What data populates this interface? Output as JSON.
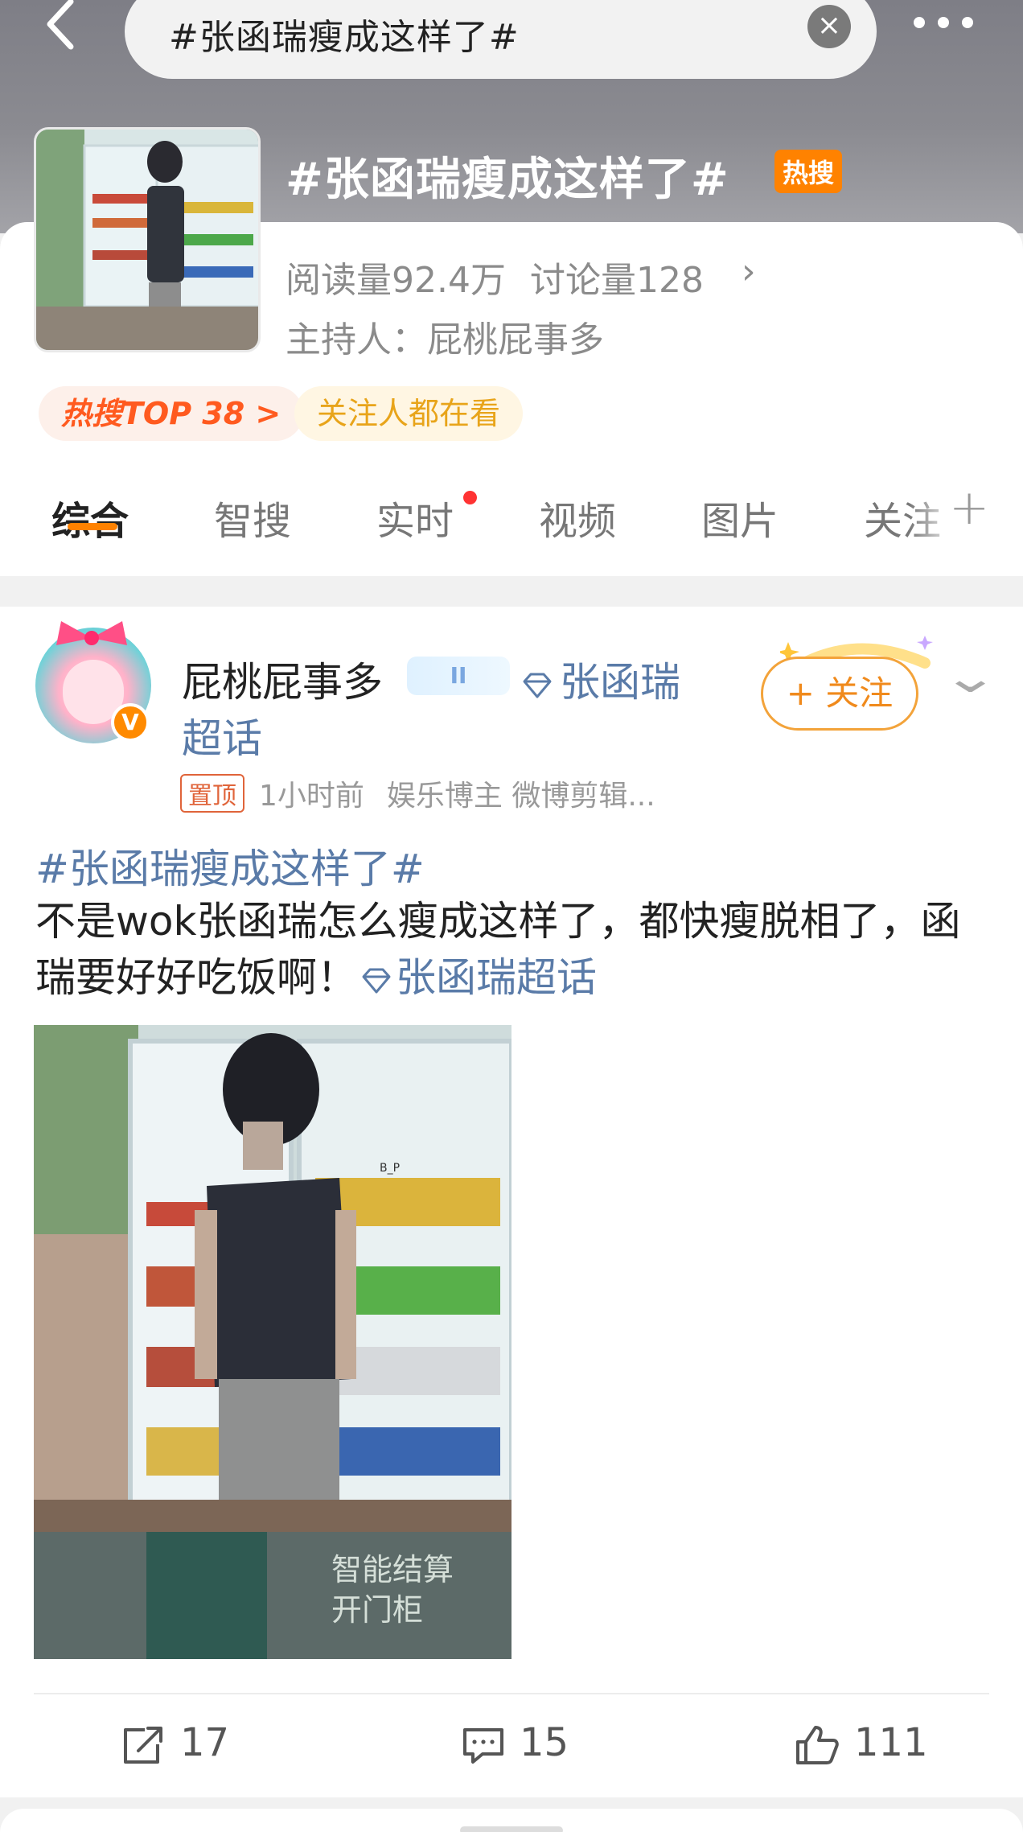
{
  "search": {
    "query": "#张函瑞瘦成这样了#"
  },
  "topic": {
    "title": "#张函瑞瘦成这样了#",
    "badge": "热搜",
    "reads": "阅读量92.4万",
    "discussions": "讨论量128",
    "host": "主持人：屁桃屁事多",
    "chips": [
      "热搜TOP 38 >",
      "关注人都在看"
    ]
  },
  "tabs": [
    {
      "label": "综合",
      "active": true
    },
    {
      "label": "智搜",
      "active": false
    },
    {
      "label": "实时",
      "active": false,
      "dot": true
    },
    {
      "label": "视频",
      "active": false
    },
    {
      "label": "图片",
      "active": false
    },
    {
      "label": "关注",
      "active": false
    }
  ],
  "post": {
    "user": {
      "name": "屁桃屁事多",
      "level": "II",
      "supertopic_line1": "张函瑞",
      "supertopic_line2": "超话",
      "verified": "V"
    },
    "follow_label": "+ 关注",
    "pinned_label": "置顶",
    "time": "1小时前",
    "bio": "娱乐博主 微博剪辑...",
    "hashtag": "#张函瑞瘦成这样了#",
    "text": "不是wok张函瑞怎么瘦成这样了，都快瘦脱相了，函瑞要好好吃饭啊！",
    "link": "张函瑞超话",
    "image_overlay_text": [
      "智能结算",
      "开门柜"
    ],
    "watermark": "B_P",
    "actions": {
      "shares": "17",
      "comments": "15",
      "likes": "111"
    }
  },
  "colors": {
    "accent": "#ff8200",
    "link": "#5a7ba8",
    "hot": "#ff5a1f"
  }
}
